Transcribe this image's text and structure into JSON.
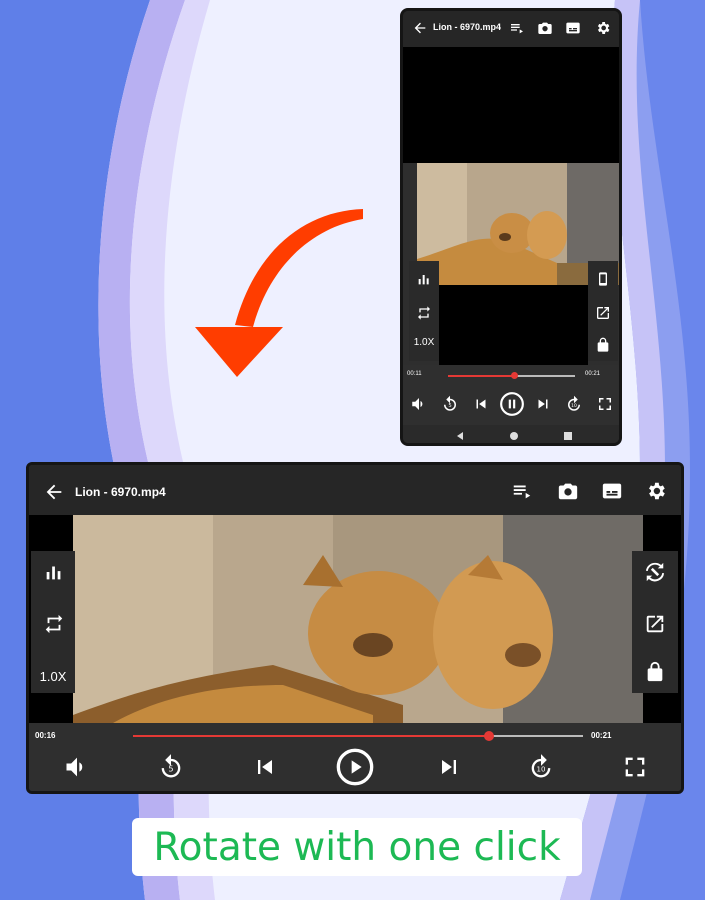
{
  "colors": {
    "accent_red": "#e53935",
    "caption_green": "#1db954",
    "arrow_orange": "#ff3d00",
    "bar_dark": "#2f2f2f"
  },
  "player": {
    "file_title": "Lion - 6970.mp4",
    "speed": "1.0X",
    "top_icons": [
      "playlist-icon",
      "camera-icon",
      "subtitle-icon",
      "gear-icon"
    ],
    "left_tools": [
      "equalizer-icon",
      "repeat-icon"
    ],
    "right_tools": [
      "rotate-icon",
      "popup-icon",
      "lock-icon"
    ]
  },
  "portrait": {
    "elapsed": "00:11",
    "duration": "00:21",
    "progress": 0.52
  },
  "landscape": {
    "elapsed": "00:16",
    "duration": "00:21",
    "progress": 0.79
  },
  "caption": {
    "text": "Rotate with one click"
  }
}
